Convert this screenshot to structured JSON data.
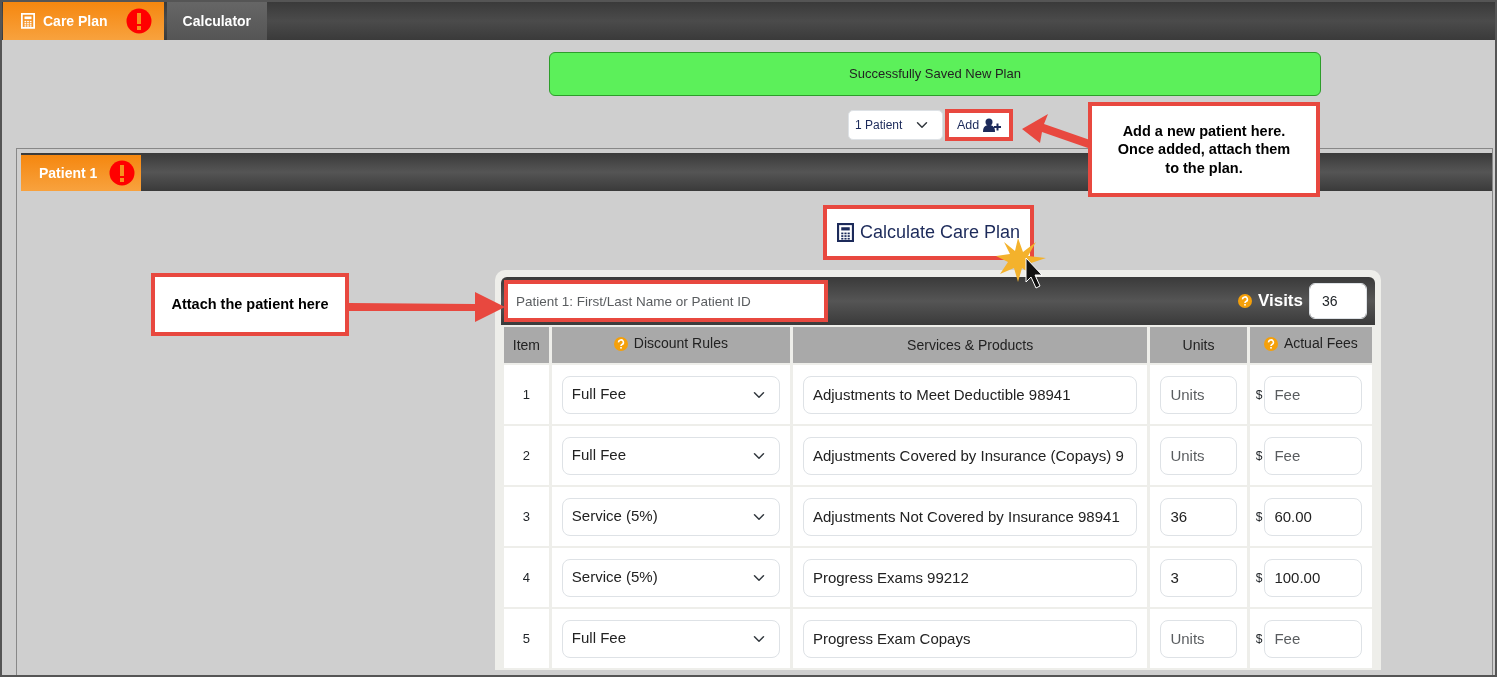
{
  "top_tabs": [
    {
      "label": "Care Plan",
      "selected": true,
      "alert": true
    },
    {
      "label": "Calculator",
      "selected": false,
      "alert": false
    }
  ],
  "alert": {
    "text": "Successfully Saved New Plan"
  },
  "patient_select": {
    "value": "1 Patient"
  },
  "add_button": {
    "label": "Add",
    "highlighted": true
  },
  "patient_tabs": [
    {
      "label": "Patient 1",
      "selected": true,
      "alert": true
    }
  ],
  "calculate_button": {
    "label": "Calculate Care Plan",
    "highlighted": true
  },
  "plan": {
    "patient_search": {
      "placeholder": "Patient 1: First/Last Name or Patient ID",
      "highlighted": true
    },
    "visits": {
      "label": "Visits",
      "help": true,
      "value": "36"
    },
    "columns": [
      {
        "label": "Item",
        "help": false
      },
      {
        "label": "Discount Rules",
        "help": true
      },
      {
        "label": "Services & Products",
        "help": false
      },
      {
        "label": "Units",
        "help": false
      },
      {
        "label": "Actual Fees",
        "help": true
      }
    ],
    "rows": [
      {
        "item": "1",
        "discount_rule": "Full Fee",
        "service": "Adjustments to Meet Deductible 98941",
        "units_placeholder": "Units",
        "currency": "$",
        "fee_placeholder": "Fee"
      },
      {
        "item": "2",
        "discount_rule": "Full Fee",
        "service": "Adjustments Covered by Insurance (Copays) 9",
        "units_placeholder": "Units",
        "currency": "$",
        "fee_placeholder": "Fee"
      },
      {
        "item": "3",
        "discount_rule": "Service (5%)",
        "service": "Adjustments Not Covered by Insurance 98941",
        "units": "36",
        "currency": "$",
        "fee": "60.00"
      },
      {
        "item": "4",
        "discount_rule": "Service (5%)",
        "service": "Progress Exams 99212",
        "units": "3",
        "currency": "$",
        "fee": "100.00"
      },
      {
        "item": "5",
        "discount_rule": "Full Fee",
        "service": "Progress Exam Copays",
        "units_placeholder": "Units",
        "currency": "$",
        "fee_placeholder": "Fee"
      }
    ]
  },
  "annotations": [
    {
      "lines": [
        "Add a new patient here.",
        "Once added, attach them",
        "to the plan."
      ]
    },
    {
      "lines": [
        "Attach the patient here"
      ]
    }
  ]
}
